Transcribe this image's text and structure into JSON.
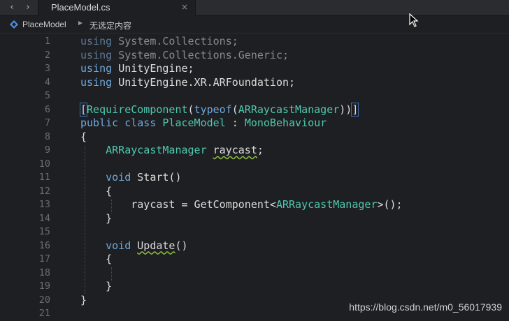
{
  "tabbar": {
    "back_label": "‹",
    "forward_label": "›",
    "active_tab": {
      "title": "PlaceModel.cs",
      "close_label": "×"
    }
  },
  "breadcrumb": {
    "icon": "class-icon",
    "item": "PlaceModel",
    "separator": "►",
    "selection": "无选定内容"
  },
  "editor": {
    "line_numbers": [
      "1",
      "2",
      "3",
      "4",
      "5",
      "6",
      "7",
      "8",
      "9",
      "10",
      "11",
      "12",
      "13",
      "14",
      "15",
      "16",
      "17",
      "18",
      "19",
      "20",
      "21"
    ],
    "lines": [
      "using System.Collections;",
      "using System.Collections.Generic;",
      "using UnityEngine;",
      "using UnityEngine.XR.ARFoundation;",
      "",
      "[RequireComponent(typeof(ARRaycastManager))]",
      "public class PlaceModel : MonoBehaviour",
      "{",
      "    ARRaycastManager raycast;",
      "",
      "    void Start()",
      "    {",
      "        raycast = GetComponent<ARRaycastManager>();",
      "    }",
      "",
      "    void Update()",
      "    {",
      "",
      "    }",
      "}",
      ""
    ]
  },
  "watermark": "https://blog.csdn.net/m0_56017939",
  "colors": {
    "keyword": "#6fa8dc",
    "type": "#4ec9b0",
    "text": "#dcdcdc",
    "line_number": "#6b6d72"
  }
}
